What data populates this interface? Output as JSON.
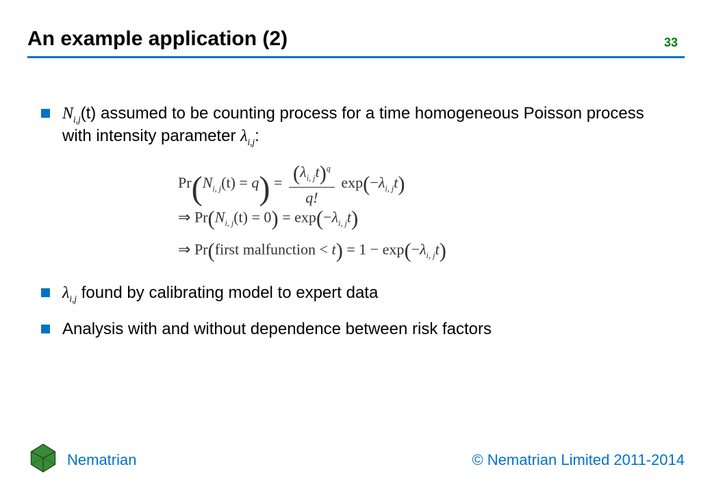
{
  "header": {
    "title": "An example application (2)",
    "page_number": "33"
  },
  "bullets": {
    "b1": {
      "var": "N",
      "var_sub": "i,j",
      "arg": "(t)",
      "rest": " assumed to be counting process for a time homogeneous Poisson process with intensity parameter ",
      "lambda": "λ",
      "lambda_sub": "i,j",
      "colon": ":"
    },
    "b2": {
      "lambda": "λ",
      "lambda_sub": "i,j",
      "rest": " found by calibrating model to expert data"
    },
    "b3": {
      "text": "Analysis with and without dependence between risk factors"
    }
  },
  "math": {
    "eq1": {
      "Pr": "Pr",
      "N": "N",
      "sub_ij": "i, j",
      "t_arg": "(t)",
      "eq": " = ",
      "q": "q",
      "lambda": "λ",
      "t": "t",
      "q_fact": "q!",
      "exp": "exp",
      "minus": "−"
    },
    "eq2": {
      "arrow": "⇒ ",
      "Pr": "Pr",
      "N": "N",
      "sub_ij": "i, j",
      "t_arg": "(t)",
      "eq": " = ",
      "zero": "0",
      "exp": "exp",
      "lambda": "λ",
      "t": "t",
      "minus": "−"
    },
    "eq3": {
      "arrow": "⇒ ",
      "Pr": "Pr",
      "inner": "first malfunction",
      "lt": " < ",
      "t": "t",
      "eq": " = ",
      "one_minus": "1 − ",
      "exp": "exp",
      "lambda": "λ",
      "sub_ij": "i, j",
      "minus": "−"
    }
  },
  "footer": {
    "brand": "Nematrian",
    "copyright": "© Nematrian Limited 2011-2014"
  },
  "colors": {
    "accent": "#0073c6",
    "green": "#008000"
  }
}
